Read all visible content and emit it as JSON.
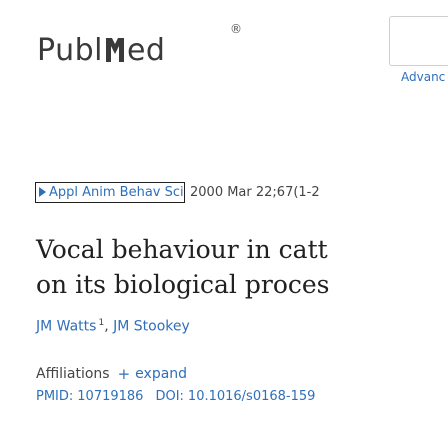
{
  "logo": {
    "text_left": "Publ",
    "text_right": "ed",
    "reg_mark": "®"
  },
  "header": {
    "advanced_label": "Advanc"
  },
  "article": {
    "journal": "Appl Anim Behav Sci",
    "citation": "2000 Mar 22;67(1-2",
    "title_line1": "Vocal behaviour in catt",
    "title_line2": "on its biological proces",
    "authors": [
      {
        "name": "JM Watts",
        "sup": "1"
      },
      {
        "name": "JM Stookey",
        "sup": ""
      }
    ],
    "author_separator": ", ",
    "affiliations_label": "Affiliations",
    "expand_label": "expand",
    "pmid_label": "PMID:",
    "pmid": "10719186",
    "doi_label": "DOI:",
    "doi": "10.1016/s0168-159"
  },
  "colors": {
    "link": "#2f6fba",
    "text": "#212121",
    "logo": "#3a3a3a"
  },
  "icons": [
    "triangle-right-icon",
    "plus-icon"
  ]
}
